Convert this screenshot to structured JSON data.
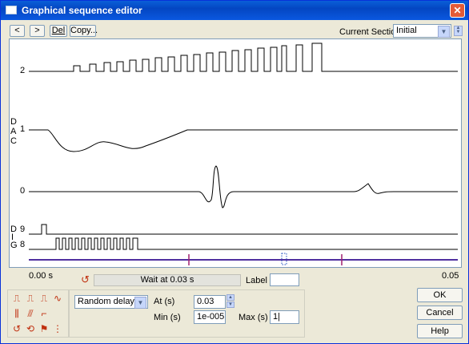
{
  "window": {
    "title": "Graphical sequence editor"
  },
  "toolbar": {
    "prev_label": "<",
    "next_label": ">",
    "del_label": "Del",
    "copy_label": "Copy...",
    "current_section_label": "Current Section",
    "current_section_value": "Initial"
  },
  "plot": {
    "channel_labels": {
      "ch2": "2",
      "ch1": "1",
      "ch0": "0",
      "ch9": "9",
      "ch8": "8"
    },
    "group_dac": [
      "D",
      "A",
      "C"
    ],
    "group_dig": [
      "D",
      "I",
      "G"
    ]
  },
  "timeline": {
    "start": "0.00 s",
    "end": "0.05",
    "status": "Wait at 0.03 s",
    "label_field_label": "Label",
    "label_value": ""
  },
  "edit": {
    "type_value": "Random delay",
    "at_label": "At (s)",
    "at_value": "0.03",
    "min_label": "Min (s)",
    "min_value": "1e-005",
    "max_label": "Max (s)",
    "max_value": "1|"
  },
  "buttons": {
    "ok": "OK",
    "cancel": "Cancel",
    "help": "Help"
  },
  "colors": {
    "title_bar": "#0a5fd8",
    "timeline": "#5030a0",
    "marker": "#a02070",
    "tool_icons": "#c03010"
  }
}
